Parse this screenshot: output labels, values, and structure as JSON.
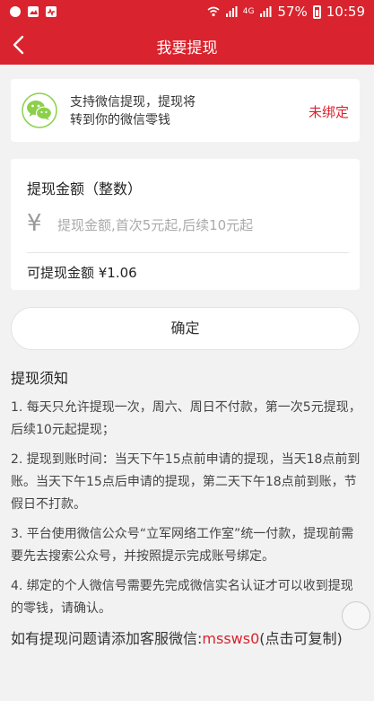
{
  "status_bar": {
    "battery": "57%",
    "time": "10:59",
    "network": "4G"
  },
  "header": {
    "title": "我要提现"
  },
  "wechat": {
    "line1": "支持微信提现，提现将",
    "line2": "转到你的微信零钱",
    "status": "未绑定"
  },
  "amount": {
    "title": "提现金额（整数）",
    "currency_symbol": "¥",
    "placeholder": "提现金额,首次5元起,后续10元起",
    "available": "可提现金额 ¥1.06"
  },
  "confirm_label": "确定",
  "notes": {
    "title": "提现须知",
    "items": [
      "1. 每天只允许提现一次，周六、周日不付款，第一次5元提现，后续10元起提现；",
      "2. 提现到账时间：当天下午15点前申请的提现，当天18点前到账。当天下午15点后申请的提现，第二天下午18点前到账，节假日不打款。",
      "3. 平台使用微信公众号“立军网络工作室”统一付款，提现前需要先去搜索公众号，并按照提示完成账号绑定。",
      "4. 绑定的个人微信号需要先完成微信实名认证才可以收到提现的零钱，请确认。"
    ],
    "contact_prefix": "如有提现问题请添加客服微信:",
    "contact_id": "mssws0",
    "contact_suffix": "(点击可复制)"
  },
  "colors": {
    "brand_red": "#d9232e",
    "wechat_green": "#8cd04a"
  }
}
